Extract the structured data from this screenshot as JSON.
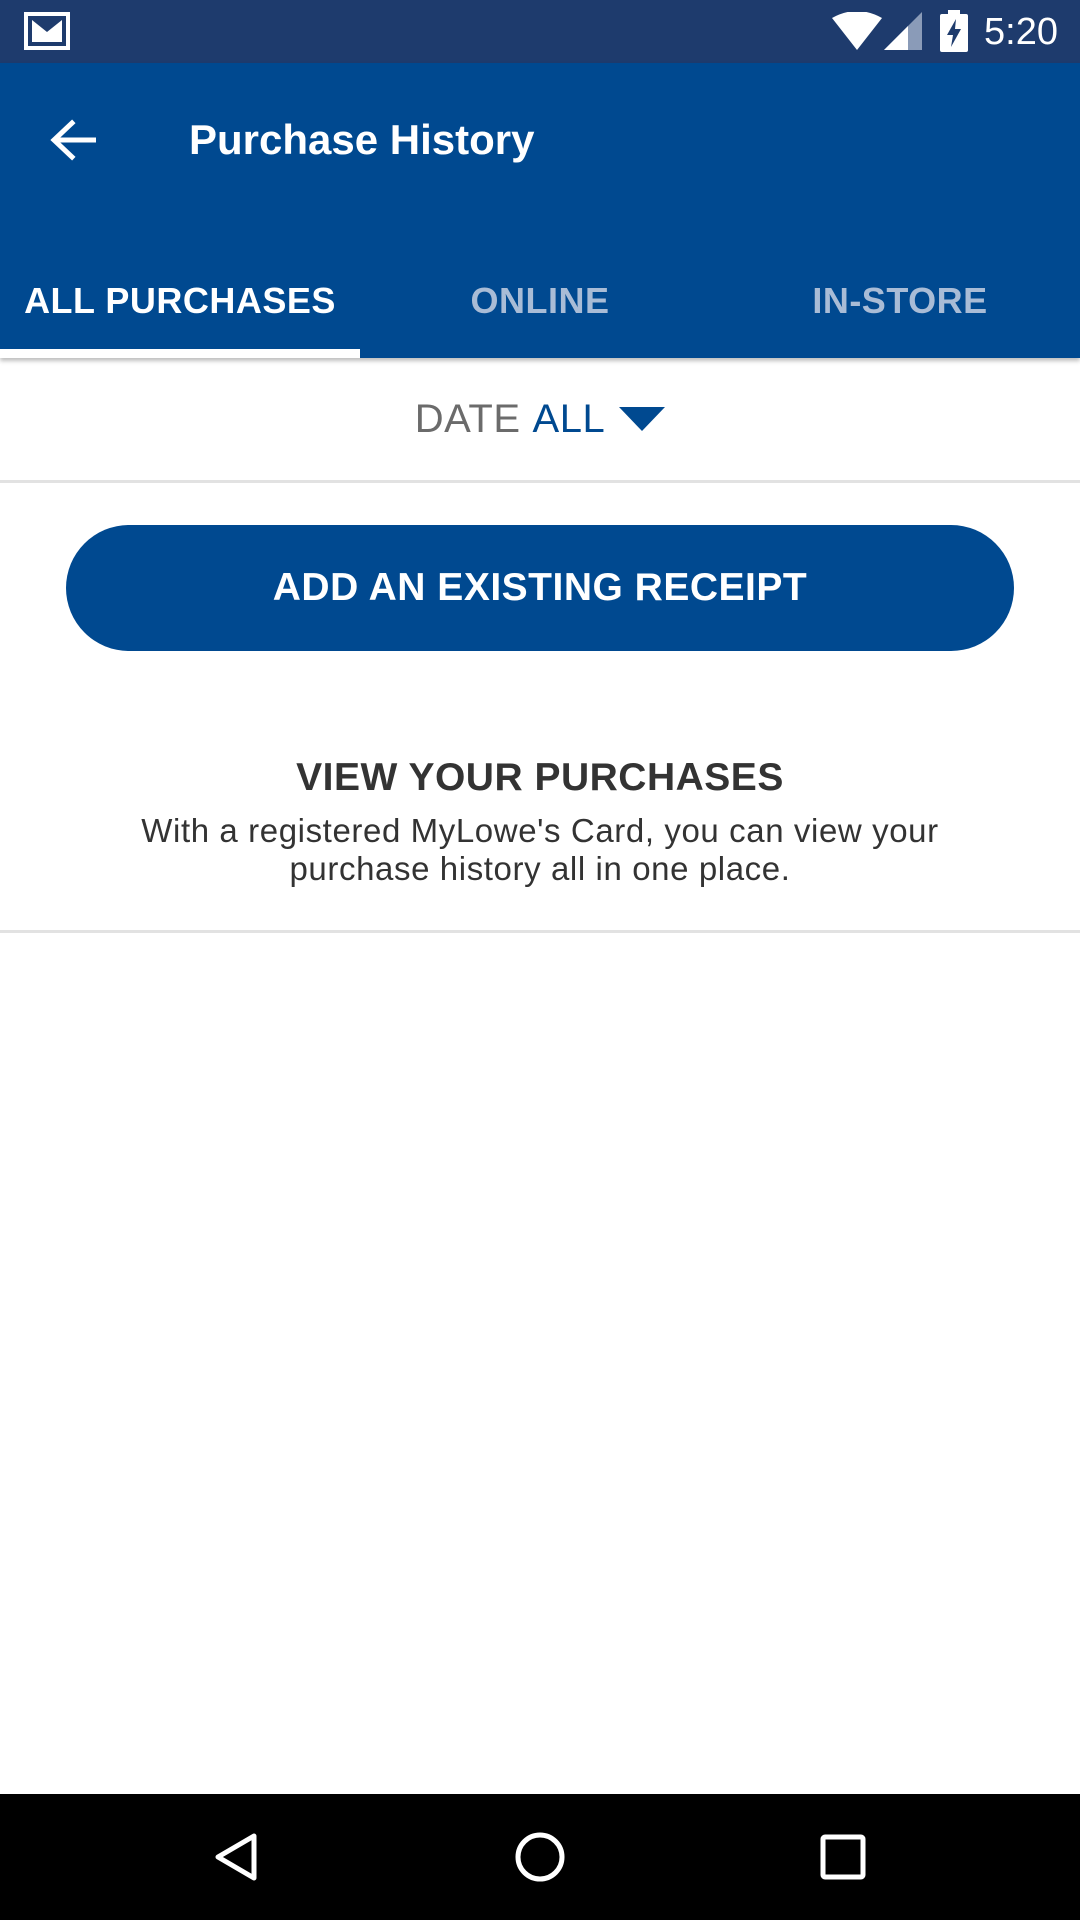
{
  "status_bar": {
    "time": "5:20",
    "icons": [
      "gmail-icon",
      "wifi-icon",
      "signal-icon",
      "battery-charging-icon"
    ]
  },
  "app_bar": {
    "title": "Purchase History",
    "back_icon": "arrow-left-icon"
  },
  "tabs": [
    {
      "label": "ALL PURCHASES",
      "active": true
    },
    {
      "label": "ONLINE",
      "active": false
    },
    {
      "label": "IN-STORE",
      "active": false
    }
  ],
  "date_filter": {
    "label": "DATE",
    "value": "ALL",
    "icon": "caret-down-icon"
  },
  "add_receipt": {
    "label": "ADD AN EXISTING RECEIPT"
  },
  "info": {
    "title": "VIEW YOUR PURCHASES",
    "text": "With a registered MyLowe's Card, you can view your purchase history all in one place."
  },
  "nav_bar": {
    "icons": [
      "nav-back-icon",
      "nav-home-icon",
      "nav-recents-icon"
    ]
  },
  "colors": {
    "status_bar": "#1e3b6d",
    "brand_blue": "#004990",
    "inactive_tab": "#a9bcd6",
    "divider": "#e2e2e2",
    "body_text": "#333333"
  }
}
